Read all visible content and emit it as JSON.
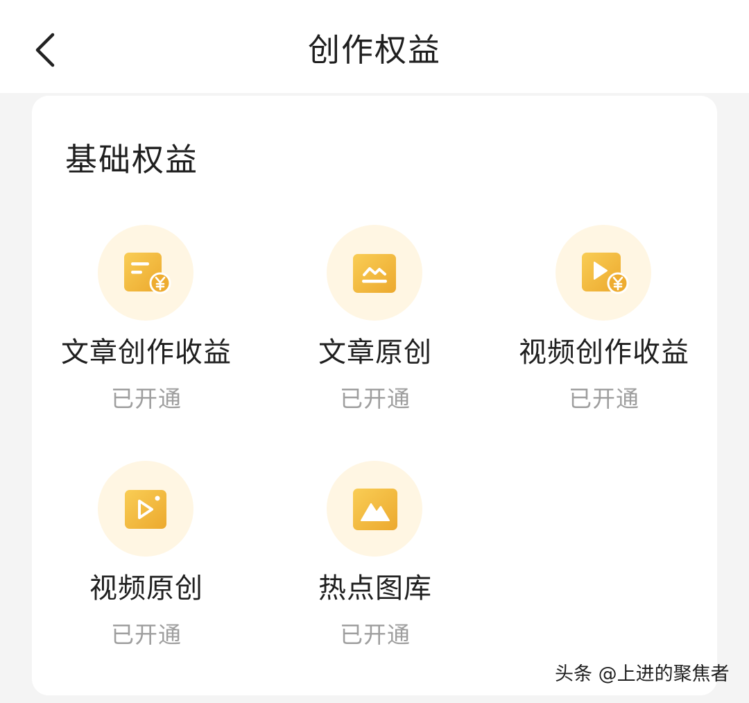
{
  "header": {
    "title": "创作权益",
    "back_icon": "chevron-left-icon"
  },
  "card": {
    "section_title": "基础权益",
    "benefits": [
      {
        "name": "文章创作收益",
        "status": "已开通",
        "icon": "article-income-icon"
      },
      {
        "name": "文章原创",
        "status": "已开通",
        "icon": "article-original-icon"
      },
      {
        "name": "视频创作收益",
        "status": "已开通",
        "icon": "video-income-icon"
      },
      {
        "name": "视频原创",
        "status": "已开通",
        "icon": "video-original-icon"
      },
      {
        "name": "热点图库",
        "status": "已开通",
        "icon": "image-gallery-icon"
      }
    ]
  },
  "watermark": "头条 @上进的聚焦者",
  "colors": {
    "icon_gold": "#f2b636",
    "icon_circle_bg": "#fff6e3",
    "status_gray": "#9e9e9e"
  }
}
